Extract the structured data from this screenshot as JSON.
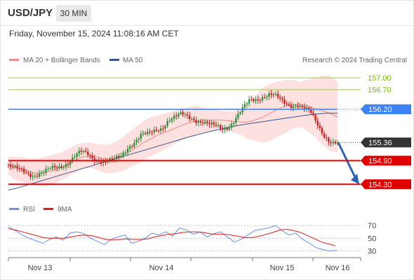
{
  "header": {
    "symbol": "USD/JPY",
    "timeframe": "30 MIN",
    "datetime": "Friday, November 15, 2024 11:08:16 AM CET"
  },
  "legend": {
    "main": [
      {
        "label": "MA 20 + Bollinger Bands",
        "color": "#f28b82"
      },
      {
        "label": "MA 50",
        "color": "#34568b"
      }
    ],
    "credit": "Research © 2024 Trading Central",
    "rsi": [
      {
        "label": "RSI",
        "color": "#6a8fe8"
      },
      {
        "label": "9MA",
        "color": "#e01b1b"
      }
    ]
  },
  "chart_data": [
    {
      "type": "candlestick",
      "title": "USD/JPY 30 MIN",
      "ylim": [
        153.95,
        157.25
      ],
      "x_labels": [
        "Nov 13",
        "Nov 14",
        "Nov 15",
        "Nov 16"
      ],
      "last_price": 155.36,
      "levels": [
        {
          "value": 157.0,
          "label": "157.00",
          "style": "resistance-green",
          "color": "#9acd32"
        },
        {
          "value": 156.7,
          "label": "156.70",
          "style": "resistance-green",
          "color": "#9acd32"
        },
        {
          "value": 156.2,
          "label": "156.20",
          "style": "pivot",
          "color": "#3b82f6"
        },
        {
          "value": 155.36,
          "label": "155.36",
          "style": "last",
          "color": "#333333"
        },
        {
          "value": 154.9,
          "label": "154.90",
          "style": "support",
          "color": "#e00000"
        },
        {
          "value": 154.3,
          "label": "154.30",
          "style": "support",
          "color": "#e00000"
        }
      ],
      "price_path": [
        154.8,
        154.7,
        154.65,
        154.6,
        154.55,
        154.58,
        154.62,
        154.7,
        154.75,
        154.85,
        155.0,
        155.1,
        155.05,
        154.95,
        154.92,
        154.88,
        154.9,
        155.0,
        155.25,
        155.4,
        155.55,
        155.55,
        155.65,
        155.75,
        155.95,
        156.0,
        156.05,
        156.0,
        155.95,
        155.9,
        155.8,
        155.75,
        155.7,
        155.8,
        156.0,
        156.2,
        156.4,
        156.45,
        156.55,
        156.6,
        156.5,
        156.35,
        156.3,
        156.35,
        156.25,
        156.1,
        155.8,
        155.55,
        155.4,
        155.36
      ],
      "ma20": [
        154.8,
        154.72,
        154.66,
        154.61,
        154.58,
        154.6,
        154.65,
        154.73,
        154.82,
        154.92,
        155.0,
        155.02,
        154.98,
        154.94,
        154.95,
        155.0,
        155.1,
        155.22,
        155.35,
        155.45,
        155.55,
        155.62,
        155.7,
        155.78,
        155.85,
        155.9,
        155.92,
        155.93,
        155.93,
        155.92,
        155.9,
        155.88,
        155.88,
        155.93,
        156.0,
        156.1,
        156.2,
        156.28,
        156.32,
        156.32,
        156.28,
        156.22,
        156.16,
        156.1,
        156.0
      ],
      "ma50": [
        154.15,
        154.22,
        154.3,
        154.38,
        154.46,
        154.54,
        154.62,
        154.7,
        154.78,
        154.86,
        154.94,
        155.02,
        155.1,
        155.18,
        155.26,
        155.34,
        155.42,
        155.5,
        155.57,
        155.64,
        155.7,
        155.76,
        155.81,
        155.85,
        155.89,
        155.93,
        155.97,
        156.01,
        156.05,
        156.08,
        156.1,
        156.1
      ],
      "bb_upper": [
        155.0,
        155.0,
        154.98,
        154.95,
        154.95,
        155.0,
        155.05,
        155.1,
        155.2,
        155.3,
        155.35,
        155.35,
        155.32,
        155.3,
        155.35,
        155.45,
        155.6,
        155.75,
        155.9,
        156.0,
        156.05,
        156.1,
        156.15,
        156.2,
        156.25,
        156.3,
        156.25,
        156.2,
        156.18,
        156.15,
        156.15,
        156.2,
        156.35,
        156.55,
        156.75,
        156.85,
        156.9,
        156.95,
        156.95,
        156.9,
        156.95,
        157.0,
        157.05,
        157.05,
        156.9
      ],
      "bb_lower": [
        154.55,
        154.4,
        154.35,
        154.3,
        154.25,
        154.25,
        154.3,
        154.4,
        154.5,
        154.6,
        154.7,
        154.72,
        154.65,
        154.58,
        154.58,
        154.62,
        154.7,
        154.8,
        154.9,
        155.0,
        155.1,
        155.2,
        155.3,
        155.4,
        155.5,
        155.55,
        155.6,
        155.65,
        155.7,
        155.68,
        155.62,
        155.55,
        155.45,
        155.4,
        155.35,
        155.4,
        155.5,
        155.6,
        155.7,
        155.75,
        155.65,
        155.5,
        155.3,
        155.15,
        155.1
      ],
      "projection": {
        "from": 155.36,
        "to": 154.3
      }
    },
    {
      "type": "line",
      "title": "RSI",
      "ylim": [
        25,
        80
      ],
      "y_ticks": [
        70,
        50,
        30
      ],
      "series": [
        {
          "name": "RSI",
          "values": [
            68,
            62,
            55,
            50,
            46,
            42,
            48,
            52,
            47,
            58,
            60,
            57,
            50,
            45,
            40,
            48,
            52,
            55,
            42,
            45,
            50,
            58,
            55,
            60,
            53,
            66,
            63,
            56,
            60,
            52,
            57,
            60,
            52,
            44,
            48,
            55,
            62,
            64,
            66,
            70,
            62,
            55,
            58,
            48,
            42,
            35,
            32,
            30,
            31
          ]
        },
        {
          "name": "9MA",
          "values": [
            65,
            63,
            60,
            57,
            54,
            51,
            50,
            50,
            50,
            52,
            54,
            55,
            54,
            51,
            48,
            47,
            48,
            49,
            48,
            48,
            49,
            52,
            54,
            56,
            57,
            59,
            60,
            60,
            59,
            57,
            56,
            56,
            55,
            53,
            51,
            51,
            53,
            56,
            59,
            63,
            64,
            62,
            59,
            54,
            49,
            44,
            41,
            38
          ]
        }
      ]
    }
  ]
}
